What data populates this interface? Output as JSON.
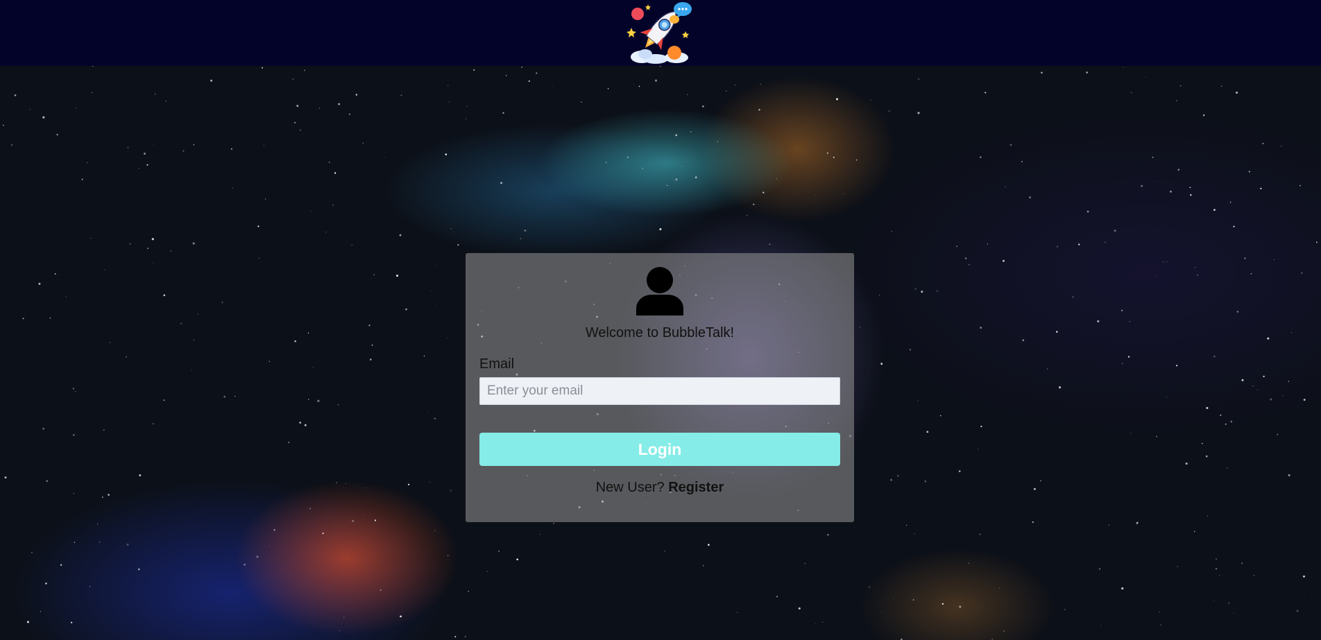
{
  "header": {
    "logo_icon": "rocket-chat-bubbles-logo",
    "background_color": "#03032a"
  },
  "login": {
    "welcome_text": "Welcome to BubbleTalk!",
    "avatar_icon": "user-icon",
    "email_label": "Email",
    "email_placeholder": "Enter your email",
    "email_value": "",
    "login_button_label": "Login",
    "login_button_color": "#85ece7",
    "new_user_text": "New User? ",
    "register_link_label": "Register"
  }
}
